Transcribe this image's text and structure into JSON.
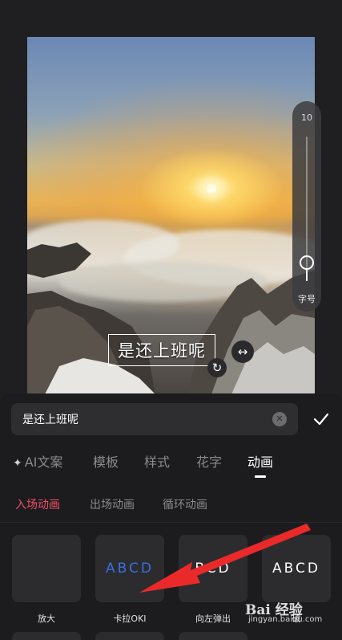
{
  "preview": {
    "caption": "是还上班呢"
  },
  "size_slider": {
    "max_value": "10",
    "label": "字号",
    "level_fraction": 0.92
  },
  "input": {
    "value": "是还上班呢",
    "clear_icon": "clear-circle-icon",
    "confirm_icon": "checkmark-icon"
  },
  "tabs": [
    {
      "label": "AI文案",
      "icon": "sparkle-icon"
    },
    {
      "label": "模板"
    },
    {
      "label": "样式"
    },
    {
      "label": "花字"
    },
    {
      "label": "动画",
      "active": true
    }
  ],
  "subtabs": [
    {
      "label": "入场动画",
      "active": true
    },
    {
      "label": "出场动画"
    },
    {
      "label": "循环动画"
    }
  ],
  "animations": [
    {
      "label": "放大",
      "preview": ""
    },
    {
      "label": "卡拉OKI",
      "preview": "ABCD",
      "preview_color": "#3a6fe0"
    },
    {
      "label": "向左弹出",
      "preview": "BCD"
    },
    {
      "label": "破",
      "preview": "ABCD"
    }
  ],
  "watermark": {
    "logo": "Bai 经验",
    "url": "jingyan.baidu.com"
  },
  "colors": {
    "accent_red": "#f24e68",
    "background": "#1f1f21",
    "panel": "#1c1c1e"
  }
}
